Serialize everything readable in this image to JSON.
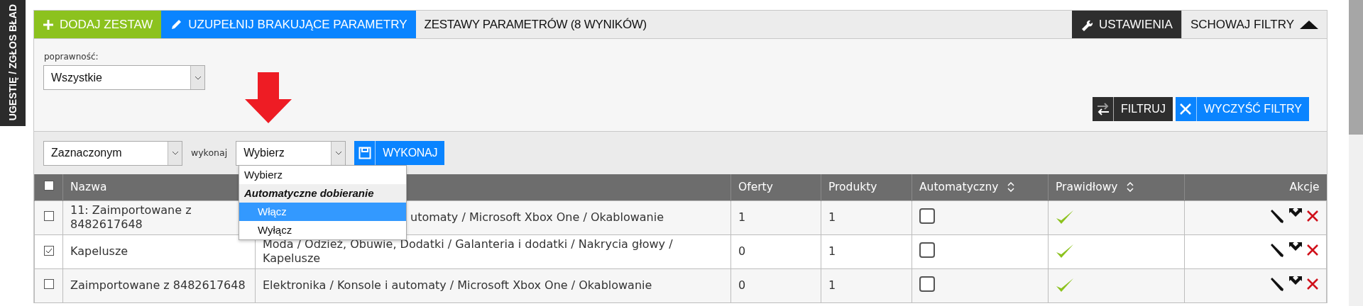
{
  "side_tab": {
    "label": "UGESTIĘ / ZGŁOS BŁAD"
  },
  "toolbar": {
    "add_button": "DODAJ ZESTAW",
    "fill_button": "UZUPEŁNIJ BRAKUJĄCE PARAMETRY",
    "title": "ZESTAWY PARAMETRÓW (8 WYNIKÓW)",
    "settings_button": "USTAWIENIA",
    "hide_filters_button": "SCHOWAJ FILTRY"
  },
  "filters": {
    "label": "poprawność:",
    "select_value": "Wszystkie",
    "filter_button": "FILTRUJ",
    "clear_button": "WYCZYŚĆ FILTRY"
  },
  "bulk": {
    "scope_value": "Zaznaczonym",
    "action_label": "wykonaj",
    "action_value": "Wybierz",
    "run_button": "WYKONAJ",
    "dropdown": [
      {
        "kind": "option",
        "label": "Wybierz",
        "selected": false
      },
      {
        "kind": "group",
        "label": "Automatyczne dobieranie",
        "children": [
          {
            "label": "Włącz",
            "selected": true
          },
          {
            "label": "Wyłącz",
            "selected": false
          }
        ]
      }
    ]
  },
  "table": {
    "select_all": {
      "checked": false
    },
    "columns": [
      {
        "label": "Nazwa"
      },
      {},
      {
        "label": "Oferty"
      },
      {
        "label": "Produkty"
      },
      {
        "label": "Automatyczny",
        "sortable": true
      },
      {
        "label": "Prawidłowy",
        "sortable": true
      },
      {
        "label": "Akcje"
      }
    ],
    "rows": [
      {
        "checked": false,
        "name": "11: Zaimportowane z 8482617648",
        "category": "utomaty / Microsoft Xbox One / Okablowanie",
        "category_partial": true,
        "offers": "1",
        "products": "1",
        "automatic": false,
        "valid": true
      },
      {
        "checked": true,
        "name": "Kapelusze",
        "category": "Moda / Odzież, Obuwie, Dodatki / Galanteria i dodatki / Nakrycia głowy / Kapelusze",
        "category_partial": false,
        "offers": "0",
        "products": "1",
        "automatic": false,
        "valid": true
      },
      {
        "checked": false,
        "name": "Zaimportowane z 8482617648",
        "category": "Elektronika / Konsole i automaty / Microsoft Xbox One / Okablowanie",
        "category_partial": false,
        "offers": "0",
        "products": "1",
        "automatic": false,
        "valid": true
      }
    ]
  }
}
